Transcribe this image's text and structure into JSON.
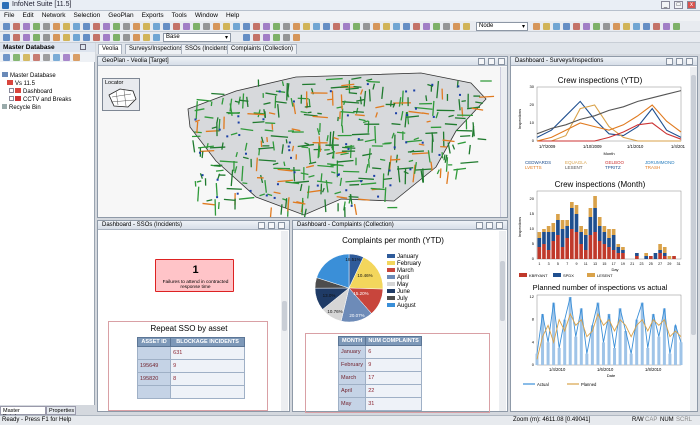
{
  "app": {
    "title": "InfoNet Suite [11.5]"
  },
  "menu": [
    "File",
    "Edit",
    "Network",
    "Selection",
    "GeoPlan",
    "Exports",
    "Tools",
    "Window",
    "Help"
  ],
  "toolbar": {
    "node_select": "Node",
    "base_select": "Base"
  },
  "left_panel": {
    "title": "Master Database",
    "tree": [
      {
        "label": "Master Database"
      },
      {
        "label": "Vs 11.5"
      },
      {
        "label": "Dashboard"
      },
      {
        "label": "CCTV and Breaks"
      },
      {
        "label": "Recycle Bin"
      }
    ],
    "bottom_tabs": [
      "Master Database",
      "Properties"
    ]
  },
  "tabs": [
    "Veolia",
    "Surveys/Inspections",
    "SSOs (Incidents)",
    "Complaints (Collection)"
  ],
  "geoplan": {
    "title": "GeoPlan - Veolia [Target]",
    "locator": "Locator"
  },
  "sso_pane": {
    "title": "Dashboard - SSOs (Incidents)",
    "alert_number": "1",
    "alert_text": "Failures to attend in contracted response time",
    "table_title": "Repeat SSO by asset",
    "headers": [
      "ASSET ID",
      "BLOCKAGE INCIDENTS"
    ],
    "rows": [
      [
        "",
        "631"
      ],
      [
        "195649",
        "9"
      ],
      [
        "195820",
        "8"
      ],
      [
        "",
        ""
      ]
    ]
  },
  "complaints_pane": {
    "title": "Dashboard - Complaints (Collection)",
    "chart_title": "Complaints per month (YTD)",
    "table_headers": [
      "MONTH",
      "NUM COMPLAINTS"
    ],
    "table_rows": [
      [
        "January",
        "6"
      ],
      [
        "February",
        "9"
      ],
      [
        "March",
        "17"
      ],
      [
        "April",
        "22"
      ],
      [
        "May",
        "31"
      ]
    ]
  },
  "surveys_pane": {
    "title": "Dashboard - Surveys/Inspections",
    "c1_title": "Crew inspections (YTD)",
    "c1_ylabel": "Inspections",
    "c1_xlabel": "Month",
    "c1_ticks": [
      "1/7/2009",
      "1/10/2009",
      "1/1/2010",
      "1/4/2010"
    ],
    "c1_legend": [
      "CEDWARDS",
      "EQUAGLA",
      "GELBOO",
      "JDRUMMOND",
      "LVETTS",
      "LESENT",
      "TPRITZ",
      "TRASH"
    ],
    "c2_title": "Crew inspections (Month)",
    "c2_ylabel": "Inspections",
    "c2_xlabel": "Day",
    "c2_legend": [
      "KBRYANT",
      "SPDX",
      "LESENT"
    ],
    "c2_ticks": [
      "1",
      "3",
      "5",
      "7",
      "9",
      "11",
      "13",
      "15",
      "17",
      "19",
      "21",
      "23",
      "25",
      "27",
      "29",
      "31"
    ],
    "c3_title": "Planned number of inspections vs actual",
    "c3_xlabel": "Date",
    "c3_ticks": [
      "1/4/2010",
      "1/6/2010",
      "1/8/2010"
    ],
    "c3_legend": [
      "Actual",
      "Planned"
    ]
  },
  "status": {
    "left": "Ready - Press F1 for Help",
    "zoom": "Zoom (m): 4611.08 [0.49041]",
    "flags": [
      "R/W",
      "CAP",
      "NUM",
      "SCRL"
    ]
  },
  "chart_data": [
    {
      "type": "pie",
      "title": "Complaints per month (YTD)",
      "categories": [
        "January",
        "February",
        "March",
        "April",
        "May",
        "June",
        "July",
        "August"
      ],
      "values": [
        7.0,
        18.51,
        13.0,
        15.2,
        10.46,
        10.76,
        5.0,
        20.07
      ],
      "data_labels": [
        "18.51%",
        "13.0%",
        "10.46%",
        "15.20%",
        "10.76%",
        "20.07%"
      ],
      "colors": [
        "#2f5b9a",
        "#f3d65c",
        "#c8453c",
        "#6d8bb8",
        "#d6d6d6",
        "#1f3b66",
        "#4d4d4d",
        "#3a8fd8"
      ]
    },
    {
      "type": "line",
      "title": "Crew inspections (YTD)",
      "xlabel": "Month",
      "ylabel": "Inspections",
      "series": [
        {
          "name": "CEDWARDS",
          "values": [
            2,
            6,
            14,
            22,
            12,
            4,
            3,
            8,
            18,
            6,
            2
          ]
        },
        {
          "name": "EQUAGLA",
          "values": [
            0,
            0,
            3,
            18,
            20,
            8,
            2,
            0,
            0,
            0,
            0
          ]
        },
        {
          "name": "GELBOO",
          "values": [
            0,
            0,
            0,
            0,
            0,
            2,
            5,
            9,
            10,
            4,
            1
          ]
        },
        {
          "name": "TPRITZ",
          "values": [
            4,
            7,
            9,
            12,
            14,
            17,
            19,
            22,
            24,
            26,
            28
          ]
        },
        {
          "name": "TRASH",
          "values": [
            0,
            2,
            6,
            10,
            8,
            6,
            9,
            14,
            20,
            11,
            5
          ]
        }
      ]
    },
    {
      "type": "bar",
      "title": "Crew inspections (Month)",
      "xlabel": "Day",
      "ylabel": "Inspections",
      "categories": [
        "1",
        "2",
        "3",
        "4",
        "5",
        "6",
        "7",
        "8",
        "9",
        "10",
        "11",
        "12",
        "13",
        "14",
        "15",
        "16",
        "17",
        "18",
        "19",
        "20",
        "21",
        "22",
        "23",
        "24",
        "25",
        "26",
        "27",
        "28",
        "29",
        "30",
        "31"
      ],
      "series": [
        {
          "name": "KBRYANT",
          "values": [
            4,
            5,
            3,
            6,
            8,
            4,
            7,
            10,
            9,
            5,
            3,
            8,
            9,
            6,
            5,
            4,
            3,
            2,
            2,
            0,
            0,
            1,
            0,
            0,
            1,
            0,
            2,
            1,
            0,
            1,
            0
          ]
        },
        {
          "name": "SPDX",
          "values": [
            3,
            4,
            6,
            3,
            5,
            6,
            4,
            7,
            6,
            4,
            5,
            6,
            8,
            5,
            4,
            3,
            5,
            2,
            1,
            0,
            0,
            1,
            0,
            1,
            0,
            2,
            1,
            1,
            0,
            0,
            0
          ]
        },
        {
          "name": "LESENT",
          "values": [
            2,
            1,
            2,
            3,
            2,
            3,
            2,
            2,
            3,
            2,
            2,
            3,
            4,
            3,
            2,
            3,
            2,
            1,
            1,
            0,
            0,
            0,
            0,
            1,
            0,
            0,
            2,
            2,
            1,
            0,
            0
          ]
        }
      ]
    },
    {
      "type": "line",
      "title": "Planned number of inspections vs actual",
      "xlabel": "Date",
      "series": [
        {
          "name": "Actual",
          "values": [
            2,
            9,
            4,
            11,
            3,
            8,
            12,
            5,
            10,
            2,
            7,
            11,
            4,
            9,
            3,
            10,
            6,
            2,
            8,
            11,
            3,
            9,
            5,
            10,
            2,
            7,
            4
          ]
        },
        {
          "name": "Planned",
          "values": [
            1,
            5,
            7,
            4,
            8,
            6,
            9,
            7,
            8,
            5,
            6,
            9,
            7,
            8,
            6,
            8,
            7,
            5,
            7,
            8,
            6,
            8,
            7,
            8,
            5,
            6,
            5
          ]
        }
      ]
    }
  ]
}
